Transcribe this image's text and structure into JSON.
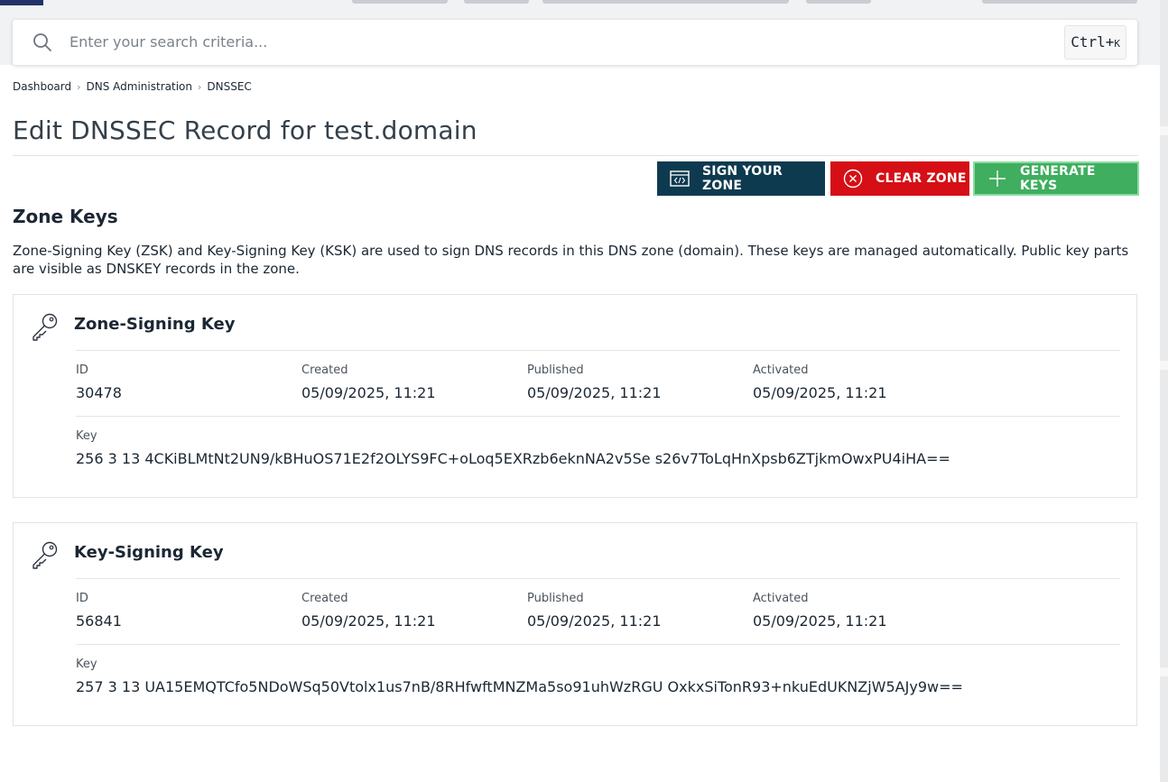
{
  "search": {
    "placeholder": "Enter your search criteria...",
    "shortcut_main": "Ctrl+",
    "shortcut_key": "K"
  },
  "breadcrumb": [
    "Dashboard",
    "DNS Administration",
    "DNSSEC"
  ],
  "page_title": "Edit DNSSEC Record for test.domain",
  "buttons": {
    "sign": "SIGN YOUR ZONE",
    "clear": "CLEAR ZONE",
    "generate": "GENERATE KEYS"
  },
  "colors": {
    "sign": "#0e3a4f",
    "clear": "#d50f15",
    "generate": "#3fae5f"
  },
  "section": {
    "title": "Zone Keys",
    "description": "Zone-Signing Key (ZSK) and Key-Signing Key (KSK) are used to sign DNS records in this DNS zone (domain). These keys are managed automatically. Public key parts are visible as DNSKEY records in the zone."
  },
  "labels": {
    "id": "ID",
    "created": "Created",
    "published": "Published",
    "activated": "Activated",
    "key": "Key"
  },
  "keys": [
    {
      "title": "Zone-Signing Key",
      "id": "30478",
      "created": "05/09/2025, 11:21",
      "published": "05/09/2025, 11:21",
      "activated": "05/09/2025, 11:21",
      "key": "256 3 13 4CKiBLMtNt2UN9/kBHuOS71E2f2OLYS9FC+oLoq5EXRzb6eknNA2v5Se s26v7ToLqHnXpsb6ZTjkmOwxPU4iHA=="
    },
    {
      "title": "Key-Signing Key",
      "id": "56841",
      "created": "05/09/2025, 11:21",
      "published": "05/09/2025, 11:21",
      "activated": "05/09/2025, 11:21",
      "key": "257 3 13 UA15EMQTCfo5NDoWSq50Vtolx1us7nB/8RHfwftMNZMa5so91uhWzRGU OxkxSiTonR93+nkuEdUKNZjW5AJy9w=="
    }
  ]
}
